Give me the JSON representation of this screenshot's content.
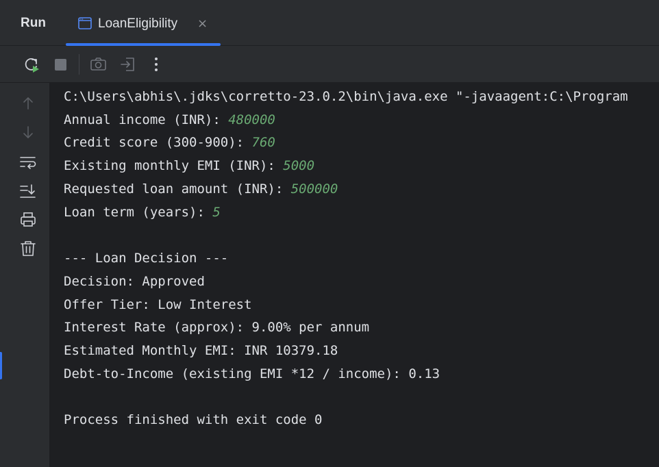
{
  "panel": {
    "title": "Run"
  },
  "tab": {
    "label": "LoanEligibility",
    "close": "×"
  },
  "toolbar": {
    "rerun": "rerun-icon",
    "stop": "stop-icon",
    "screenshot": "camera-icon",
    "restore": "restore-layout-icon",
    "more": "more-vertical-icon"
  },
  "sidebar": {
    "icons": [
      "arrow-up-icon",
      "arrow-down-icon",
      "soft-wrap-icon",
      "scroll-to-end-icon",
      "print-icon",
      "trash-icon"
    ]
  },
  "console": {
    "cmd": "C:\\Users\\abhis\\.jdks\\corretto-23.0.2\\bin\\java.exe \"-javaagent:C:\\Program",
    "prompts": [
      {
        "label": "Annual income (INR): ",
        "value": "480000"
      },
      {
        "label": "Credit score (300-900): ",
        "value": "760"
      },
      {
        "label": "Existing monthly EMI (INR): ",
        "value": "5000"
      },
      {
        "label": "Requested loan amount (INR): ",
        "value": "500000"
      },
      {
        "label": "Loan term (years): ",
        "value": "5"
      }
    ],
    "decision_header": "--- Loan Decision ---",
    "results": [
      "Decision: Approved",
      "Offer Tier: Low Interest",
      "Interest Rate (approx): 9.00% per annum",
      "Estimated Monthly EMI: INR 10379.18",
      "Debt-to-Income (existing EMI *12 / income): 0.13"
    ],
    "finish": "Process finished with exit code 0"
  },
  "colors": {
    "accent": "#3574f0",
    "input_text": "#6aab73",
    "background": "#1e1f22",
    "panel": "#2b2d30"
  }
}
